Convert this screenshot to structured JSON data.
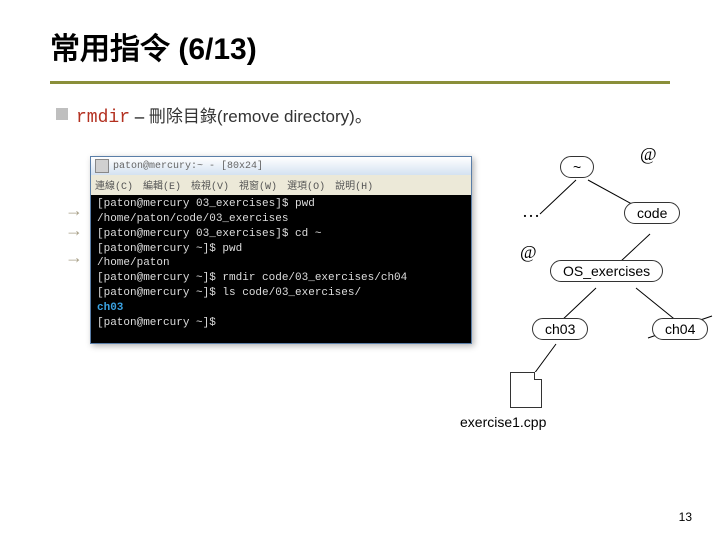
{
  "title": "常用指令 (6/13)",
  "bullet": {
    "cmd": "rmdir",
    "sep": " – ",
    "text": "刪除目錄(remove directory)。"
  },
  "terminal": {
    "winTitle": "paton@mercury:~ - [80x24]",
    "menus": [
      "連線(C)",
      "編輯(E)",
      "檢視(V)",
      "視窗(W)",
      "選項(O)",
      "說明(H)"
    ],
    "lines": [
      "[paton@mercury 03_exercises]$ pwd",
      "/home/paton/code/03_exercises",
      "[paton@mercury 03_exercises]$ cd ~",
      "[paton@mercury ~]$ pwd",
      "/home/paton",
      "[paton@mercury ~]$ rmdir code/03_exercises/ch04",
      "[paton@mercury ~]$ ls code/03_exercises/"
    ],
    "highlight": "ch03",
    "lastPrompt": "[paton@mercury ~]$ "
  },
  "tree": {
    "annot_top": "@",
    "annot_mid": "@",
    "dots": "…",
    "root": "~",
    "code": "code",
    "osx": "OS_exercises",
    "ch03": "ch03",
    "ch04": "ch04",
    "file": "exercise1.cpp"
  },
  "pageNum": "13"
}
